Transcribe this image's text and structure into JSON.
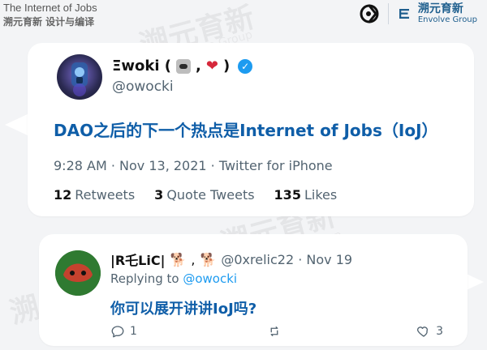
{
  "header": {
    "title": "The Internet of Jobs",
    "subtitle": "溯元育新 设计与编译"
  },
  "brand": {
    "cn": "溯元育新",
    "en": "Envolve Group"
  },
  "tweet": {
    "display_name": "Ξwoki (",
    "display_name_suffix": ",",
    "display_name_end": ")",
    "handle": "@owocki",
    "text": "DAO之后的下一个热点是Internet of Jobs（IoJ）",
    "time": "9:28 AM · Nov 13, 2021 · Twitter for iPhone",
    "stats": [
      {
        "num": "12",
        "label": "Retweets"
      },
      {
        "num": "3",
        "label": "Quote Tweets"
      },
      {
        "num": "135",
        "label": "Likes"
      }
    ]
  },
  "reply": {
    "name": "|R乇LiC|",
    "handle_and_date": "@0xrelic22 · Nov 19",
    "replying_prefix": "Replying to",
    "replying_to": "@owocki",
    "text": "你可以展开讲讲IoJ吗?",
    "actions": {
      "replies": "1",
      "retweets": "",
      "likes": "3"
    }
  },
  "colors": {
    "background": "#f3f4f6",
    "card": "#ffffff",
    "link": "#1d9bf0",
    "highlight_text": "#0f5ea8",
    "muted": "#536471"
  }
}
